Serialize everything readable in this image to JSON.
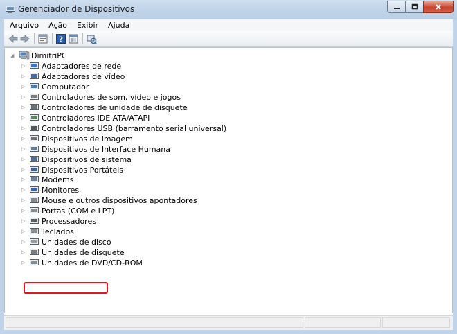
{
  "window": {
    "title": "Gerenciador de Dispositivos",
    "icon": "device-manager-icon",
    "caption_buttons": {
      "minimize": "minimize-icon",
      "maximize": "maximize-icon",
      "close": "close-icon"
    }
  },
  "menu": [
    "Arquivo",
    "Ação",
    "Exibir",
    "Ajuda"
  ],
  "toolbar": [
    "back-icon",
    "forward-icon",
    "properties-icon",
    "help-icon",
    "view-icon",
    "scan-hardware-icon"
  ],
  "tree": {
    "root": "DimitriPC",
    "items": [
      {
        "label": "Adaptadores de rede",
        "icon": "network-adapter-icon"
      },
      {
        "label": "Adaptadores de vídeo",
        "icon": "display-adapter-icon"
      },
      {
        "label": "Computador",
        "icon": "computer-icon"
      },
      {
        "label": "Controladores de som, vídeo e jogos",
        "icon": "sound-icon"
      },
      {
        "label": "Controladores de unidade de disquete",
        "icon": "floppy-controller-icon"
      },
      {
        "label": "Controladores IDE ATA/ATAPI",
        "icon": "ide-controller-icon"
      },
      {
        "label": "Controladores USB (barramento serial universal)",
        "icon": "usb-icon"
      },
      {
        "label": "Dispositivos de imagem",
        "icon": "camera-icon"
      },
      {
        "label": "Dispositivos de Interface Humana",
        "icon": "hid-icon"
      },
      {
        "label": "Dispositivos de sistema",
        "icon": "system-device-icon"
      },
      {
        "label": "Dispositivos Portáteis",
        "icon": "portable-device-icon"
      },
      {
        "label": "Modems",
        "icon": "modem-icon"
      },
      {
        "label": "Monitores",
        "icon": "monitor-icon"
      },
      {
        "label": "Mouse e outros dispositivos apontadores",
        "icon": "mouse-icon"
      },
      {
        "label": "Portas (COM e LPT)",
        "icon": "port-icon"
      },
      {
        "label": "Processadores",
        "icon": "processor-icon"
      },
      {
        "label": "Teclados",
        "icon": "keyboard-icon"
      },
      {
        "label": "Unidades de disco",
        "icon": "disk-drive-icon"
      },
      {
        "label": "Unidades de disquete",
        "icon": "floppy-drive-icon"
      },
      {
        "label": "Unidades de DVD/CD-ROM",
        "icon": "dvd-drive-icon"
      }
    ],
    "highlighted_item": "Unidades de disco"
  },
  "colors": {
    "titlebar": "#c3d6ea",
    "highlight_border": "#e3141b"
  }
}
